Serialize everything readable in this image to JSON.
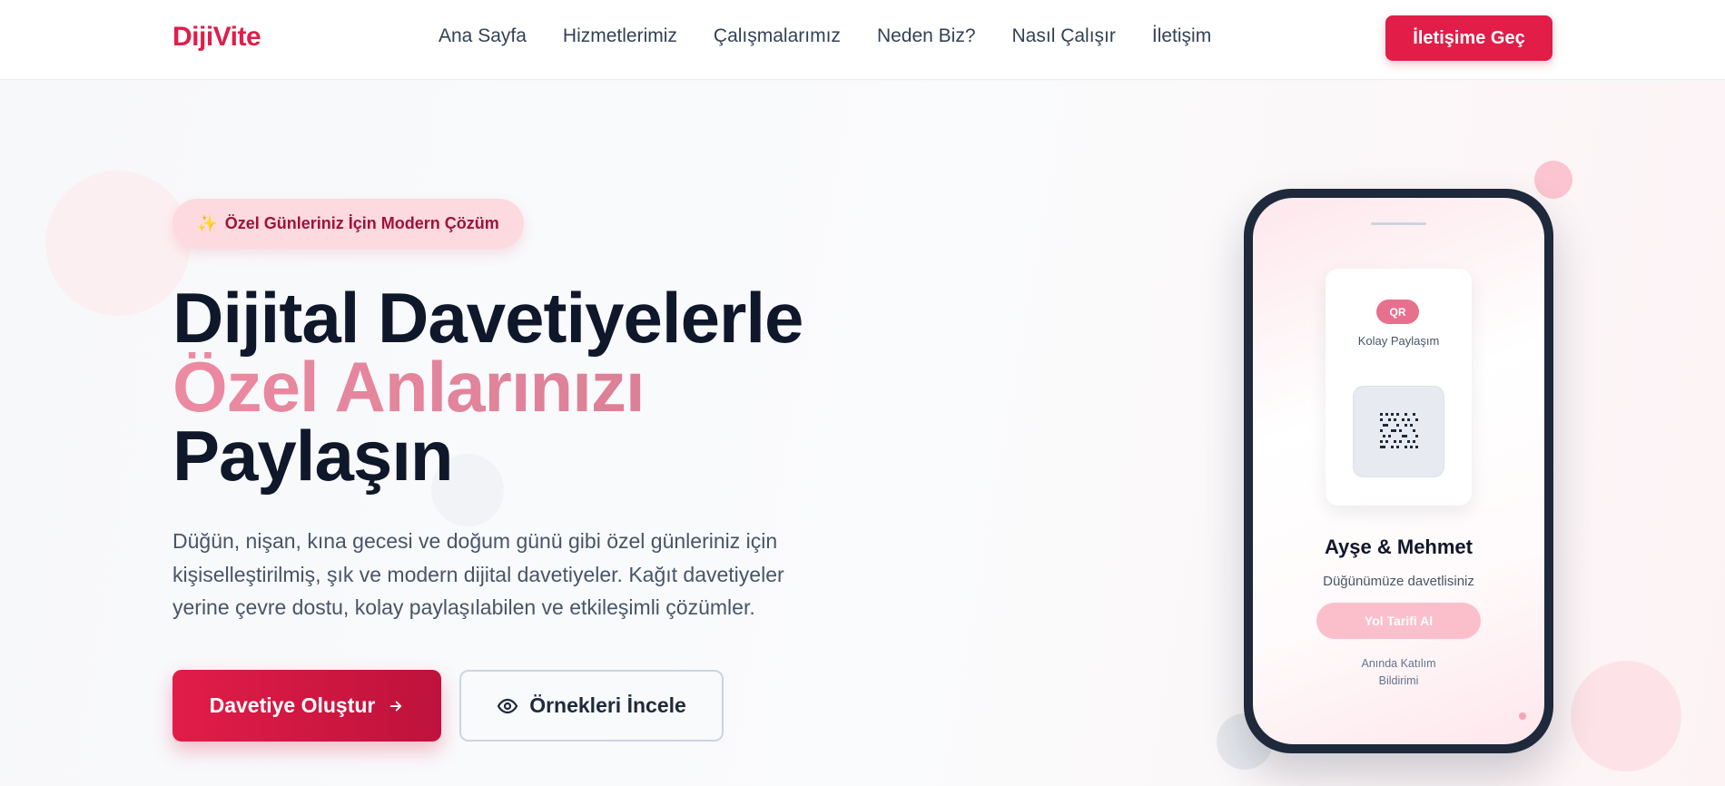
{
  "navbar": {
    "logo": "DijiVite",
    "links": [
      "Ana Sayfa",
      "Hizmetlerimiz",
      "Çalışmalarımız",
      "Neden Biz?",
      "Nasıl Çalışır",
      "İletişim"
    ],
    "cta_label": "İletişime Geç"
  },
  "hero": {
    "badge_text": "Özel Günleriniz İçin Modern Çözüm",
    "badge_icon": "sparkles-icon",
    "headline_line1": "Dijital Davetiyelerle",
    "headline_line2": "Özel Anlarınızı",
    "headline_line3": "Paylaşın",
    "description": "Düğün, nişan, kına gecesi ve doğum günü gibi özel günleriniz için kişiselleştirilmiş, şık ve modern dijital davetiyeler. Kağıt davetiyeler yerine çevre dostu, kolay paylaşılabilen ve etkileşimli çözümler.",
    "primary_button": "Davetiye Oluştur",
    "primary_button_icon": "arrow-right-icon",
    "secondary_button": "Örnekleri İncele",
    "secondary_button_icon": "eye-icon"
  },
  "phone": {
    "qr_pill": "QR",
    "qr_label": "Kolay Paylaşım",
    "couple_name": "Ayşe & Mehmet",
    "invite_text": "Düğünümüze davetlisiniz",
    "route_button": "Yol Tarifi Al",
    "rsvp_text": "Anında Katılım Bildirimi"
  },
  "colors": {
    "brand": "#e11d48",
    "heading": "#0f172a",
    "accent_gradient_start": "#ec8aa2",
    "accent_gradient_end": "#d67d93",
    "badge_bg": "#fdd9e0"
  }
}
